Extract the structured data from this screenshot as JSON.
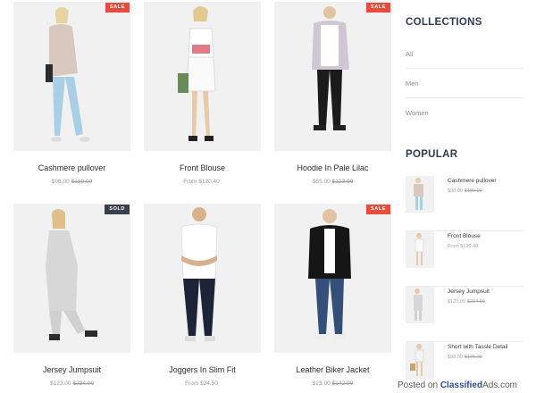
{
  "products": [
    {
      "name": "Cashmere pullover",
      "price": "$98.00",
      "old_price": "$189.00",
      "badge": "SALE"
    },
    {
      "name": "Front Blouse",
      "price": "From $120.40",
      "old_price": "",
      "badge": ""
    },
    {
      "name": "Hoodie In Pale Lilac",
      "price": "$65.00",
      "old_price": "$123.00",
      "badge": "SALE"
    },
    {
      "name": "Jersey Jumpsuit",
      "price": "$123.00",
      "old_price": "$234.00",
      "badge": "SOLD"
    },
    {
      "name": "Joggers In Slim Fit",
      "price": "From $24.50",
      "old_price": "",
      "badge": ""
    },
    {
      "name": "Leather Biker Jacket",
      "price": "$23.00",
      "old_price": "$142.00",
      "badge": "SALE"
    }
  ],
  "sidebar": {
    "collections_title": "COLLECTIONS",
    "collections": [
      "All",
      "Men",
      "Women"
    ],
    "popular_title": "POPULAR",
    "popular": [
      {
        "name": "Cashmere pullover",
        "price": "$98.00",
        "old_price": "$189.00"
      },
      {
        "name": "Front Blouse",
        "price": "From $120.40",
        "old_price": ""
      },
      {
        "name": "Jersey Jumpsuit",
        "price": "$123.00",
        "old_price": "$234.00"
      },
      {
        "name": "Short with Tassle Detail",
        "price": "$98.50",
        "old_price": "$176.00"
      }
    ]
  },
  "watermark": {
    "prefix": "Posted on ",
    "brand": "Classified",
    "suffix": "Ads.com"
  },
  "colors": {
    "sale": "#e74c3c",
    "sold": "#3a3f4a",
    "heading": "#2f3a4c"
  }
}
